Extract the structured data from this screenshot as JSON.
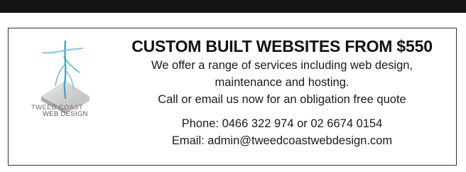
{
  "logo": {
    "line1": "TWEED COAST",
    "line2": "WEB DESIGN",
    "icon": "spire-pyramid-logo-icon"
  },
  "ad": {
    "headline": "CUSTOM BUILT WEBSITES FROM $550",
    "description": [
      "We offer a range of services including web design,",
      "maintenance and hosting.",
      "Call or email us now for an obligation free quote"
    ],
    "phone": "Phone: 0466 322 974 or 02 6674 0154",
    "email": "Email: admin@tweedcoastwebdesign.com"
  },
  "colors": {
    "top_band": "#151515",
    "logo_accent": "#3aa9cf"
  }
}
